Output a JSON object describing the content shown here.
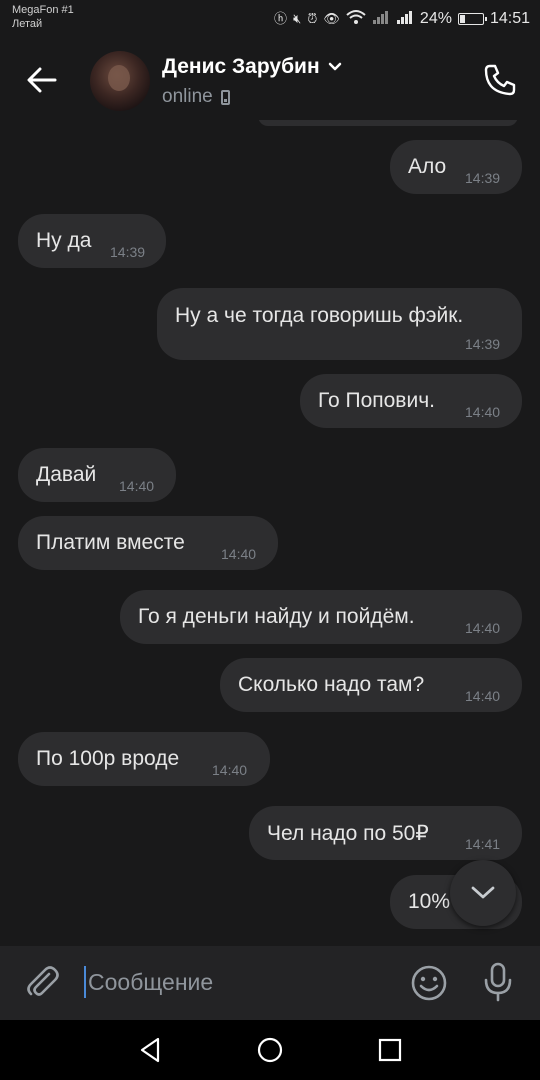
{
  "statusbar": {
    "carrier_line1": "MegaFon #1",
    "carrier_line2": "Летай",
    "battery_percent": "24%",
    "battery_level": 0.24,
    "time": "14:51"
  },
  "header": {
    "contact_name": "Денис Зарубин",
    "contact_status": "online"
  },
  "messages": [
    {
      "text": "Ало",
      "time": "14:39",
      "direction": "outgoing"
    },
    {
      "text": "Ну да",
      "time": "14:39",
      "direction": "incoming"
    },
    {
      "text": "Ну а че тогда говоришь фэйк.",
      "time": "14:39",
      "direction": "outgoing"
    },
    {
      "text": "Го Попович.",
      "time": "14:40",
      "direction": "outgoing"
    },
    {
      "text": "Давай",
      "time": "14:40",
      "direction": "incoming"
    },
    {
      "text": "Платим вместе",
      "time": "14:40",
      "direction": "incoming"
    },
    {
      "text": "Го я деньги найду и пойдём.",
      "time": "14:40",
      "direction": "outgoing"
    },
    {
      "text": "Сколько надо там?",
      "time": "14:40",
      "direction": "outgoing"
    },
    {
      "text": "По 100р вроде",
      "time": "14:40",
      "direction": "incoming"
    },
    {
      "text": "Чел надо по 50₽",
      "time": "14:41",
      "direction": "outgoing"
    },
    {
      "text": "10%",
      "time": "",
      "direction": "outgoing"
    }
  ],
  "composer": {
    "placeholder": "Сообщение"
  },
  "colors": {
    "background": "#19191a",
    "bubble": "#2d2d2f",
    "composer": "#232325",
    "accent_caret": "#4a8ad8"
  },
  "icons": [
    "back-arrow-icon",
    "chevron-down-icon",
    "phone-device-icon",
    "call-icon",
    "scroll-down-icon",
    "paperclip-icon",
    "emoji-icon",
    "mic-icon",
    "nav-back-icon",
    "nav-home-icon",
    "nav-recents-icon"
  ]
}
